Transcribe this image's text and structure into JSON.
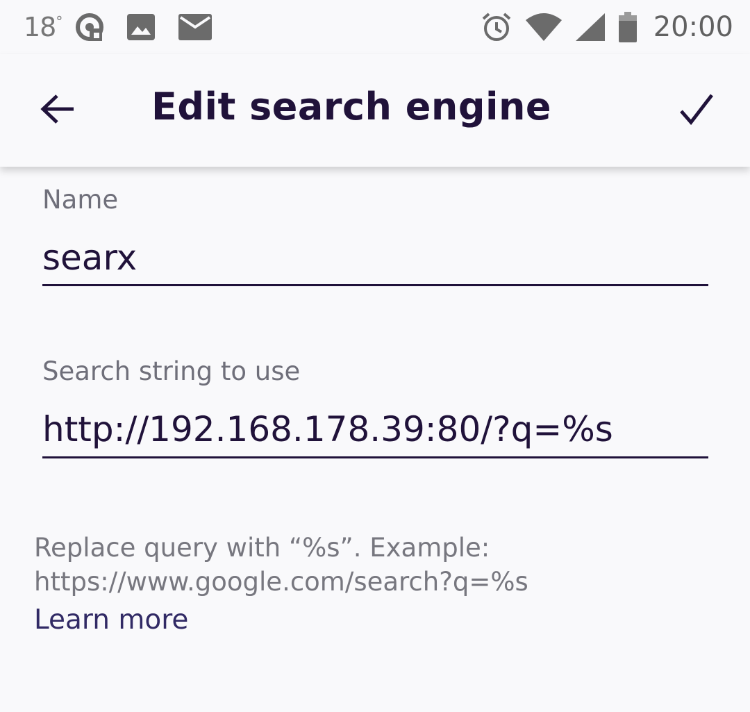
{
  "status_bar": {
    "temperature": "18",
    "temperature_unit": "°",
    "time": "20:00",
    "left_icons": [
      "podcast-app-icon",
      "image-notification-icon",
      "mail-notification-icon"
    ],
    "right_icons": [
      "alarm-icon",
      "wifi-icon",
      "cell-signal-icon",
      "battery-icon"
    ]
  },
  "toolbar": {
    "title": "Edit search engine",
    "back_icon": "arrow-back-icon",
    "confirm_icon": "checkmark-icon"
  },
  "form": {
    "name_field": {
      "label": "Name",
      "value": "searx"
    },
    "search_string_field": {
      "label": "Search string to use",
      "value": "http://192.168.178.39:80/?q=%s"
    },
    "help": {
      "line1": "Replace query with “%s”. Example:",
      "line2": "https://www.google.com/search?q=%s",
      "learn_more": "Learn more"
    }
  },
  "colors": {
    "background": "#f9f9fb",
    "primary_text": "#20123a",
    "secondary_text": "#6f6f7a",
    "link": "#312a65"
  }
}
